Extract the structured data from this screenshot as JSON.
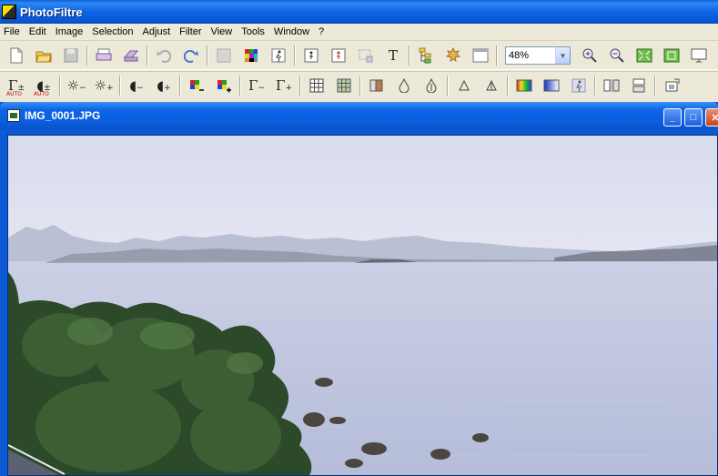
{
  "app": {
    "title": "PhotoFiltre"
  },
  "menu": [
    "File",
    "Edit",
    "Image",
    "Selection",
    "Adjust",
    "Filter",
    "View",
    "Tools",
    "Window",
    "?"
  ],
  "toolbar": {
    "zoom_value": "48%",
    "text_tool_label": "T",
    "auto_label": "AUTO"
  },
  "document": {
    "title": "IMG_0001.JPG"
  },
  "colors": {
    "title_blue": "#0c59d6",
    "chrome": "#ece9d8",
    "sky": "#dfe3f2",
    "water": "#bfc6e0"
  }
}
